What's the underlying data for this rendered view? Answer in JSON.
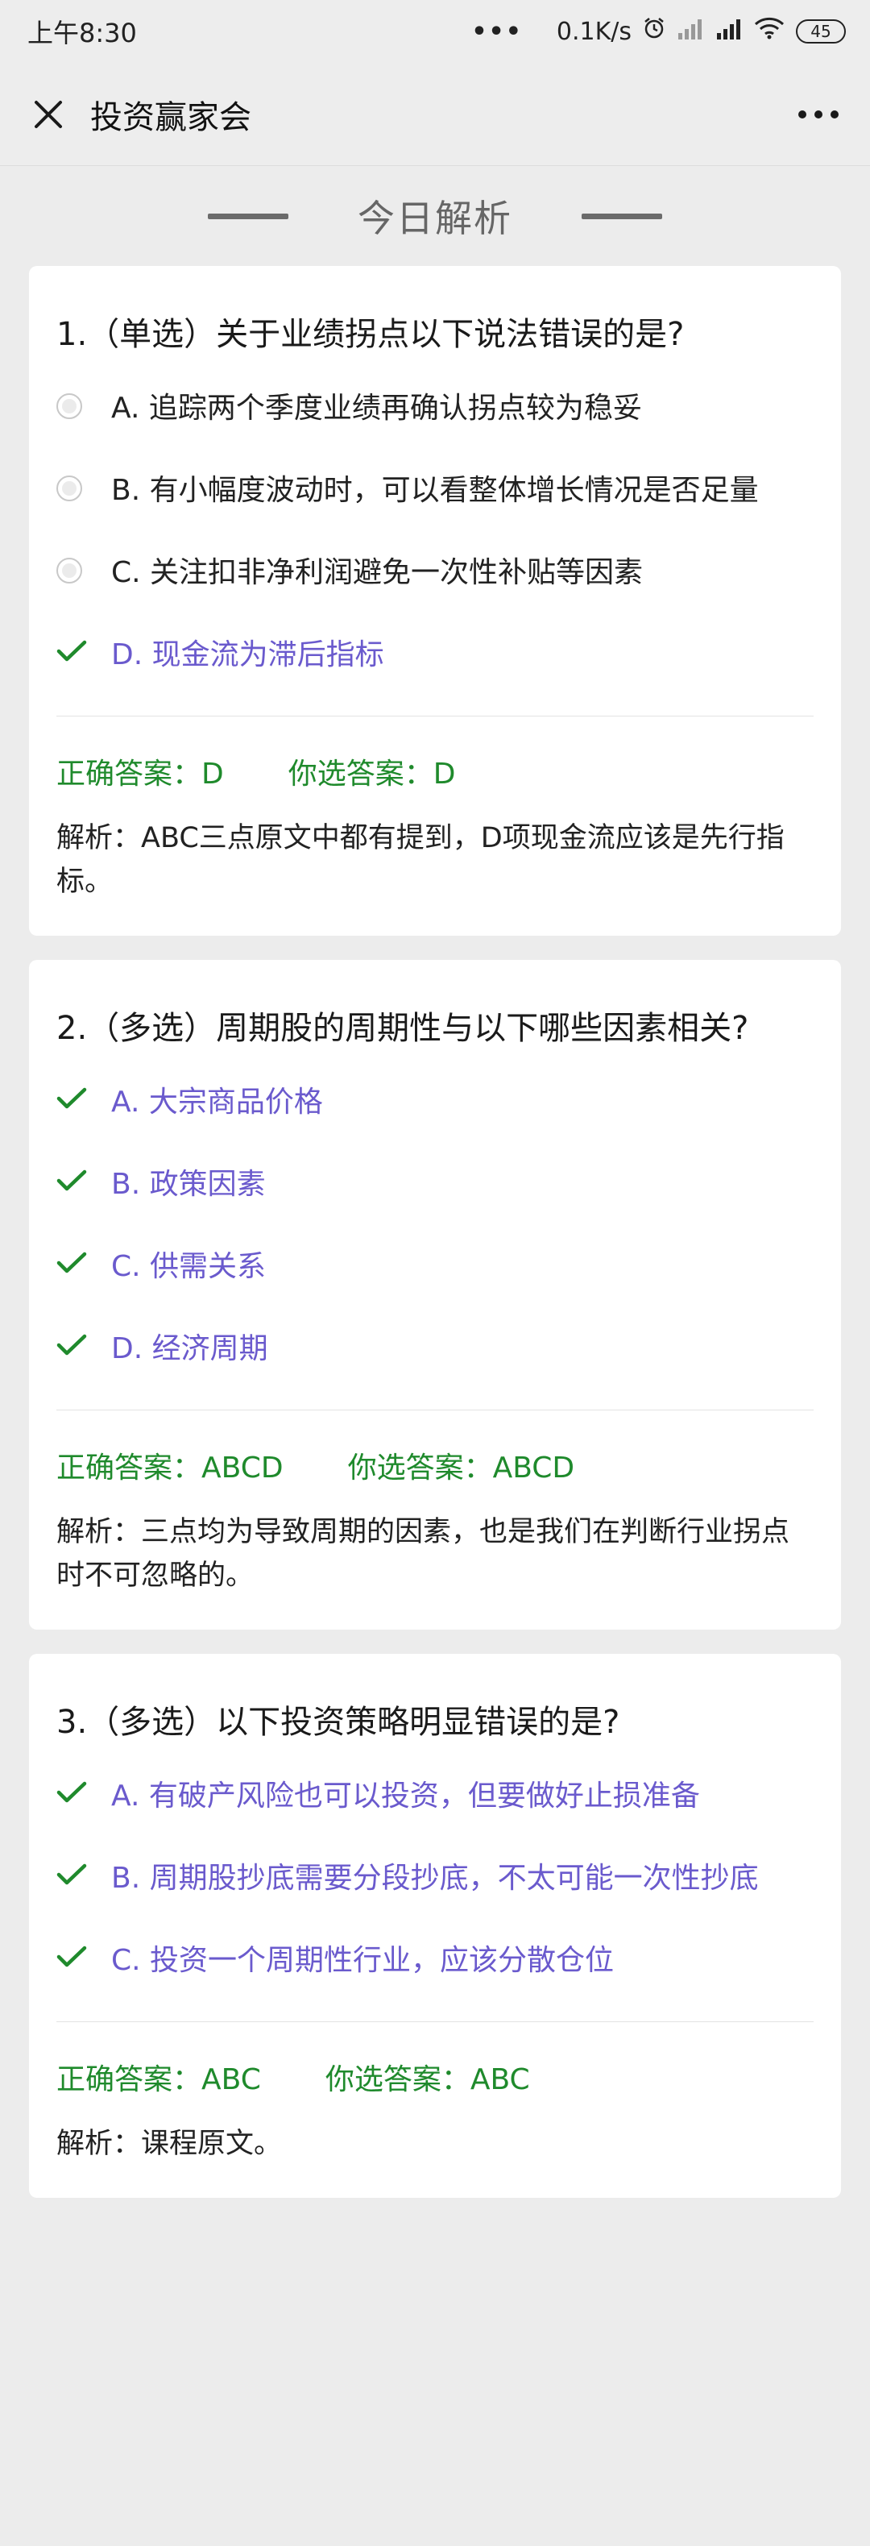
{
  "status_bar": {
    "time": "上午8:30",
    "dots": "•••",
    "speed": "0.1K/s",
    "battery": "45"
  },
  "nav": {
    "title": "投资赢家会"
  },
  "section": {
    "title": "今日解析"
  },
  "questions": [
    {
      "title": "1.（单选）关于业绩拐点以下说法错误的是?",
      "options": [
        {
          "text": "A. 追踪两个季度业绩再确认拐点较为稳妥",
          "selected": false
        },
        {
          "text": "B. 有小幅度波动时，可以看整体增长情况是否足量",
          "selected": false
        },
        {
          "text": "C. 关注扣非净利润避免一次性补贴等因素",
          "selected": false
        },
        {
          "text": "D. 现金流为滞后指标",
          "selected": true
        }
      ],
      "correct": "正确答案：D",
      "yours": "你选答案：D",
      "explanation": "解析：ABC三点原文中都有提到，D项现金流应该是先行指标。"
    },
    {
      "title": "2.（多选）周期股的周期性与以下哪些因素相关?",
      "options": [
        {
          "text": "A. 大宗商品价格",
          "selected": true
        },
        {
          "text": "B. 政策因素",
          "selected": true
        },
        {
          "text": "C. 供需关系",
          "selected": true
        },
        {
          "text": "D. 经济周期",
          "selected": true
        }
      ],
      "correct": "正确答案：ABCD",
      "yours": "你选答案：ABCD",
      "explanation": "解析：三点均为导致周期的因素，也是我们在判断行业拐点时不可忽略的。"
    },
    {
      "title": "3.（多选）以下投资策略明显错误的是?",
      "options": [
        {
          "text": "A. 有破产风险也可以投资，但要做好止损准备",
          "selected": true
        },
        {
          "text": "B. 周期股抄底需要分段抄底，不太可能一次性抄底",
          "selected": true
        },
        {
          "text": "C. 投资一个周期性行业，应该分散仓位",
          "selected": true
        }
      ],
      "correct": "正确答案：ABC",
      "yours": "你选答案：ABC",
      "explanation": "解析：课程原文。"
    }
  ],
  "colors": {
    "selected_option": "#6a5acd",
    "check": "#1f8a2c",
    "answer_text": "#1f8a2c"
  }
}
